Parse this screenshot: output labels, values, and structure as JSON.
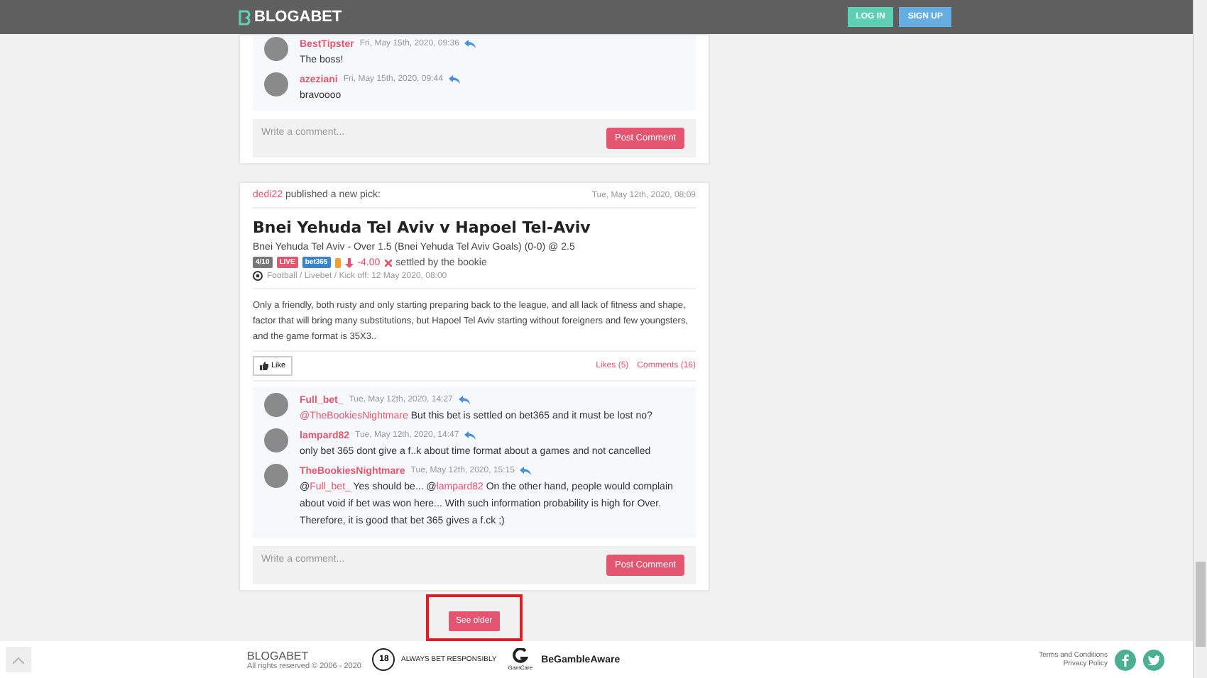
{
  "header": {
    "logo": "BLOGABET",
    "buttons": [
      {
        "label": "LOG IN",
        "kind": "login"
      },
      {
        "label": "SIGN UP",
        "kind": "signup"
      }
    ]
  },
  "top_card": {
    "comments": [
      {
        "user": "BestTipster",
        "time": "Fri, May 15th, 2020, 09:36",
        "parts": [
          {
            "kind": "text",
            "text": "The boss!"
          }
        ]
      },
      {
        "user": "azeziani",
        "time": "Fri, May 15th, 2020, 09:44",
        "parts": [
          {
            "kind": "text",
            "text": "bravoooo"
          }
        ]
      }
    ],
    "form": {
      "placeholder": "Write a comment...",
      "button": "Post Comment"
    }
  },
  "pick_card": {
    "publisher": "dedi22",
    "action": "published a new pick:",
    "time": "Tue, May 12th, 2020, 08:09",
    "title": "Bnei Yehuda Tel Aviv v Hapoel Tel-Aviv",
    "pick": "Bnei Yehuda Tel Aviv - Over 1.5 (Bnei Yehuda Tel Aviv Goals) (0-0) @ 2.5",
    "stake": "4/10",
    "live": "LIVE",
    "bookie": "bet365",
    "result": "-4.00",
    "settled": "settled by the bookie",
    "meta": "Football / Livebet / Kick off: 12 May 2020, 08:00",
    "analysis": "Only a friendly, both rusty and only starting preparing back to the league, and all lack of fitness and shape, factor that will bring many substitutions, but Hapoel Tel Aviv starting without foreigners and few youngsters, and the game format is 35X3..",
    "like": "Like",
    "likes": "Likes (5)",
    "comments_link": "Comments (16)",
    "comments": [
      {
        "user": "Full_bet_",
        "time": "Tue, May 12th, 2020, 14:27",
        "parts": [
          {
            "kind": "mention",
            "text": "@TheBookiesNightmare"
          },
          {
            "kind": "text",
            "text": " But this bet is settled on bet365 and it must be lost no?"
          }
        ]
      },
      {
        "user": "lampard82",
        "time": "Tue, May 12th, 2020, 14:47",
        "parts": [
          {
            "kind": "text",
            "text": "only bet 365 dont give a f..k about time format about a games and not cancelled"
          }
        ]
      },
      {
        "user": "TheBookiesNightmare",
        "time": "Tue, May 12th, 2020, 15:15",
        "parts": [
          {
            "kind": "text",
            "text": "@"
          },
          {
            "kind": "mention",
            "text": "Full_bet_"
          },
          {
            "kind": "text",
            "text": " Yes should be... @"
          },
          {
            "kind": "mention",
            "text": "lampard82"
          },
          {
            "kind": "text",
            "text": " On the other hand, people would complain about void if bet was won here... With such information probability is high for Over. Therefore, it is good that bet 365 gives a f.ck ;)"
          }
        ]
      }
    ],
    "form": {
      "placeholder": "Write a comment...",
      "button": "Post Comment"
    }
  },
  "see_older": "See older",
  "footer": {
    "brand": "BLOGABET",
    "rights": "All rights reserved © 2006 - 2020",
    "age": "18",
    "responsible": "ALWAYS BET RESPONSIBLY",
    "gamcare": "GamCare",
    "gamble_aware": "BeGambleAware",
    "links": [
      "Terms and Conditions",
      "Privacy Policy"
    ]
  }
}
